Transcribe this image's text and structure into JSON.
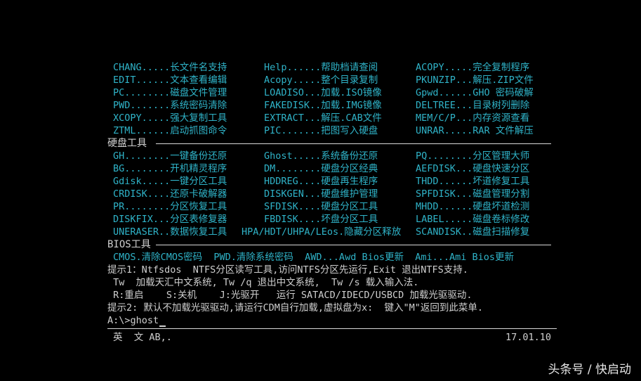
{
  "menu_rows": [
    [
      "CHANG.....长文件名支持",
      "Help......帮助档请查阅",
      "ACOPY.....完全复制程序"
    ],
    [
      "EDIT......文本查看编辑",
      "Acopy.....整个目录复制",
      "PKUNZIP...解压.ZIP文件"
    ],
    [
      "PC........磁盘文件管理",
      "LOADISO...加载.ISO镜像",
      "Gpwd......GHO 密码破解"
    ],
    [
      "PWD.......系统密码清除",
      "FAKEDISK..加载.IMG镜像",
      "DELTREE...目录树列删除"
    ],
    [
      "XCOPY.....强大复制工具",
      "EXTRACT...解压.CAB文件",
      "MEM/C/P...内存资源查看"
    ],
    [
      "ZTML......启动抓图命令",
      "PIC.......把图写入硬盘",
      "UNRAR.....RAR 文件解压"
    ]
  ],
  "disk_section": "硬盘工具",
  "disk_rows": [
    [
      "GH........一键备份还原",
      "Ghost.....系统备份还原",
      "PQ........分区管理大师"
    ],
    [
      "BG........开机精灵程序",
      "DM........硬盘分区经典",
      "AEFDISK...硬盘快速分区"
    ],
    [
      "Gdisk.....一键分区工具",
      "HDDREG....硬盘再生程序",
      "THDD......坏道修复工具"
    ],
    [
      "CRDISK....还原卡破解器",
      "DISKGEN...硬盘维护管理",
      "SPFDISK...磁盘管理分割"
    ],
    [
      "PR........分区恢复工具",
      "SFDISK....硬盘分区工具",
      "MHDD......硬盘坏道检测"
    ],
    [
      "DISKFIX...分区表修复器",
      "FBDISK....坏盘分区工具",
      "LABEL.....磁盘卷标修改"
    ]
  ],
  "disk_last_row": [
    "UNERASER..数据恢复工具",
    "HPA/HDT/UHPA/LEos.隐藏分区释放",
    "SCANDISK..磁盘扫描修复"
  ],
  "bios_section": "BIOS工具",
  "bios_row": "CMOS.清除CMOS密码  PWD.清除系统密码  AWD...Awd Bios更新  Ami...Ami Bios更新",
  "tips": [
    "提示1：Ntfsdos  NTFS分区读写工具,访问NTFS分区先运行,Exit 退出NTFS支持.",
    " Tw  加载天汇中文系统, Tw /q 退出中文系统,  Tw /s 载入输入法.",
    " R:重启    S:关机    J:光驱开   运行 SATACD/IDECD/USBCD 加载光驱驱动.",
    "提示2: 默认不加载光驱驱动,请运行CDM自行加载,虚拟盘为x:  键入\"M\"返回到此菜单."
  ],
  "prompt": "A:\\>ghost",
  "status": {
    "left": "英  文 AB,.",
    "time": "17.01.10"
  },
  "watermark": "头条号 / 快启动"
}
